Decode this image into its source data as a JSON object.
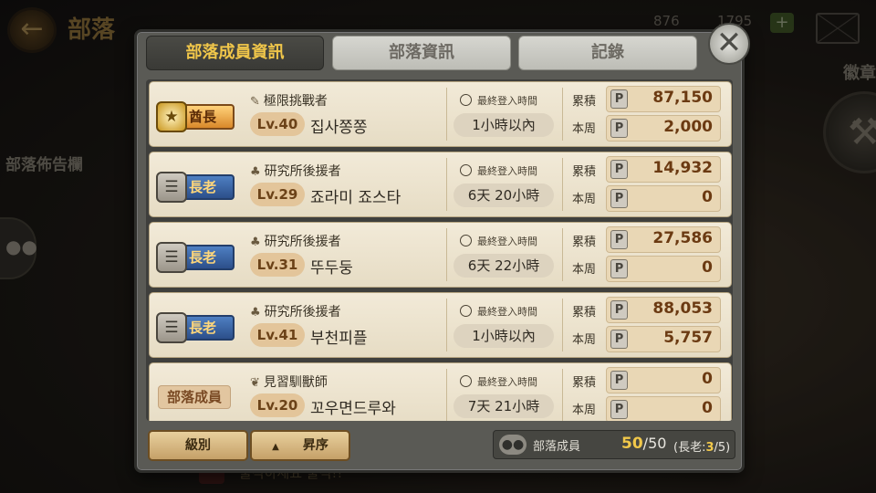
{
  "background": {
    "title": "部落",
    "resource_1": "876",
    "resource_2": "1795",
    "notice_board": "部落佈告欄",
    "badge_label": "徽章",
    "ticker": "출석하세요 출석!!"
  },
  "tabs": [
    "部落成員資訊",
    "部落資訊",
    "記錄"
  ],
  "labels": {
    "last_login": "最終登入時間",
    "accumulated": "累積",
    "this_week": "本周",
    "points_glyph": "P"
  },
  "members": [
    {
      "rank": "酋長",
      "rank_type": "chief",
      "title": "極限挑戰者",
      "level": "Lv.40",
      "name": "집사쫑쫑",
      "last_login": "1小時以內",
      "accumulated": "87,150",
      "weekly": "2,000"
    },
    {
      "rank": "長老",
      "rank_type": "elder",
      "title": "研究所後援者",
      "level": "Lv.29",
      "name": "죠라미 죠스타",
      "last_login": "6天 20小時",
      "accumulated": "14,932",
      "weekly": "0"
    },
    {
      "rank": "長老",
      "rank_type": "elder",
      "title": "研究所後援者",
      "level": "Lv.31",
      "name": "뚜두둥",
      "last_login": "6天 22小時",
      "accumulated": "27,586",
      "weekly": "0"
    },
    {
      "rank": "長老",
      "rank_type": "elder",
      "title": "研究所後援者",
      "level": "Lv.41",
      "name": "부천피플",
      "last_login": "1小時以內",
      "accumulated": "88,053",
      "weekly": "5,757"
    },
    {
      "rank": "部落成員",
      "rank_type": "member",
      "title": "見習馴獸師",
      "level": "Lv.20",
      "name": "꼬우면드루와",
      "last_login": "7天 21小時",
      "accumulated": "0",
      "weekly": "0"
    }
  ],
  "footer": {
    "grade_button": "級別",
    "order_button": "昇序",
    "member_label": "部落成員",
    "member_count": "50",
    "member_total": "/50",
    "elder_prefix": "(長老:",
    "elder_count": "3",
    "elder_suffix": "/5)"
  },
  "icons": {
    "back": "arrow-left-icon",
    "close": "close-icon",
    "clock": "clock-icon",
    "points": "points-icon",
    "mail": "mail-icon"
  },
  "colors": {
    "active_tab_text": "#f0c64a",
    "point_value": "#6b3a12",
    "member_count": "#f1c84a"
  }
}
